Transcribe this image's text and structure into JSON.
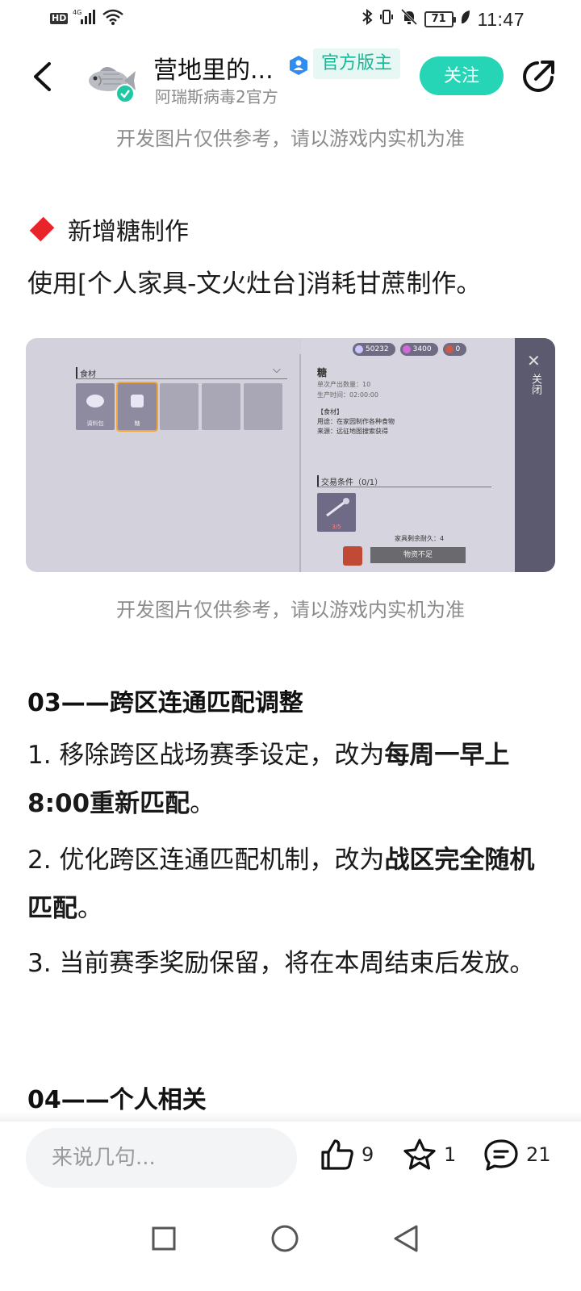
{
  "status_bar": {
    "network": "HD",
    "network_gen": "4G",
    "battery_level": "71",
    "time": "11:47"
  },
  "header": {
    "title": "营地里的...",
    "mod_badge": "官方版主",
    "subtitle": "阿瑞斯病毒2官方",
    "follow_label": "关注",
    "accent_color": "#26d5b5"
  },
  "article": {
    "caption_top": "开发图片仅供参考，请以游戏内实机为准",
    "sugar_section_title": "新增糖制作",
    "sugar_desc": "使用[个人家具-文火灶台]消耗甘蔗制作。",
    "caption_mid": "开发图片仅供参考，请以游戏内实机为准",
    "heading_03": "03——跨区连通匹配调整",
    "item1_prefix": "1. 移除跨区战场赛季设定，改为",
    "item1_bold": "每周一早上8:00重新匹配",
    "item1_suffix": "。",
    "item2_prefix": "2. 优化跨区连通匹配机制，改为",
    "item2_bold": "战区完全随机匹配",
    "item2_suffix": "。",
    "item3": "3. 当前赛季奖励保留，将在本周结束后发放。",
    "heading_04": "04——个人相关"
  },
  "game_screenshot": {
    "resources": [
      "50232",
      "3400",
      "0"
    ],
    "category_label": "食材",
    "slots": [
      {
        "label": "调料包"
      },
      {
        "label": "糖"
      }
    ],
    "item_name": "糖",
    "output_count_label": "单次产出数量：10",
    "produce_time_label": "生产时间：02:00:00",
    "ingredient_tag": "【食材】",
    "usage_text": "用途：在家园制作各种食物",
    "source_text": "来源：远征地图搜索获得",
    "trade_condition": "交易条件（0/1）",
    "trade_qty": "3/5",
    "durability_text": "家具剩余耐久：4",
    "button_label": "物资不足",
    "close_label": "关闭"
  },
  "bottom_bar": {
    "comment_placeholder": "来说几句...",
    "like_count": "9",
    "fav_count": "1",
    "comment_count": "21"
  }
}
